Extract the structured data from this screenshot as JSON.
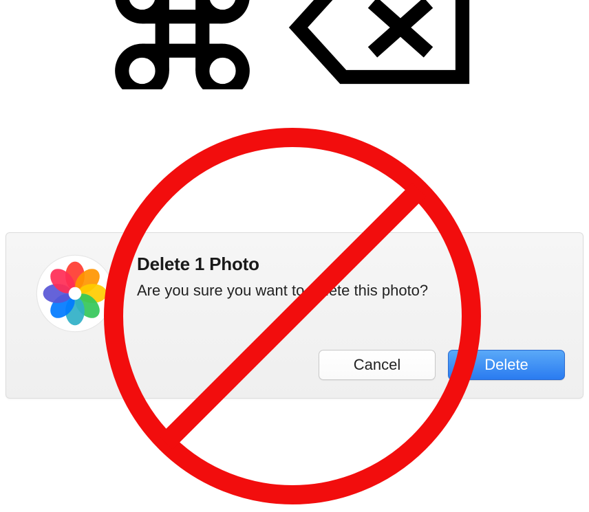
{
  "shortcut": {
    "command_icon": "command-key-icon",
    "delete_icon": "delete-key-icon"
  },
  "dialog": {
    "title": "Delete 1 Photo",
    "message": "Are you sure you want to delete this photo?",
    "app_icon": "photos-app-icon",
    "buttons": {
      "cancel": "Cancel",
      "delete": "Delete"
    }
  },
  "overlay": {
    "prohibited_icon": "prohibited-icon",
    "color": "#f20d0d"
  }
}
